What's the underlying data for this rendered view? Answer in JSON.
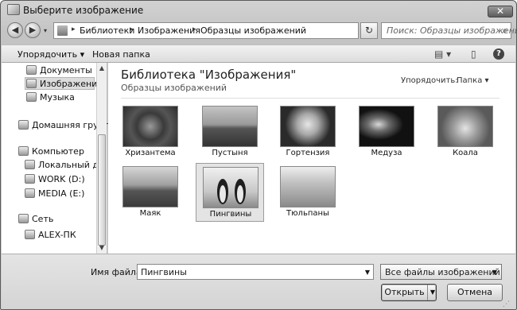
{
  "window": {
    "title": "Выберите изображение",
    "close": "✕"
  },
  "nav": {
    "back": "◀",
    "forward": "▶",
    "dropdown": "▾",
    "refresh": "↻"
  },
  "breadcrumb": [
    "Библиотеки",
    "Изображения",
    "Образцы изображений"
  ],
  "breadcrumb_sep": "▸",
  "search": {
    "placeholder": "Поиск: Образцы изображений",
    "icon": "search-icon"
  },
  "toolbar": {
    "organize": "Упорядочить ▾",
    "new_folder": "Новая папка",
    "view_icon": "▤ ▾",
    "preview_icon": "▯",
    "help_icon": "?"
  },
  "sidebar": {
    "items": [
      {
        "label": "Документы",
        "icon": "documents-icon"
      },
      {
        "label": "Изображения",
        "icon": "pictures-icon"
      },
      {
        "label": "Музыка",
        "icon": "music-icon"
      },
      {
        "label": "Домашняя группа",
        "icon": "homegroup-icon"
      },
      {
        "label": "Компьютер",
        "icon": "computer-icon"
      },
      {
        "label": "Локальный диск",
        "icon": "drive-icon"
      },
      {
        "label": "WORK (D:)",
        "icon": "drive-icon"
      },
      {
        "label": "MEDIA (E:)",
        "icon": "drive-icon"
      },
      {
        "label": "Сеть",
        "icon": "network-icon"
      },
      {
        "label": "ALEX-ПК",
        "icon": "pc-icon"
      }
    ]
  },
  "library": {
    "title": "Библиотека \"Изображения\"",
    "subtitle": "Образцы изображений",
    "arrange_label": "Упорядочить:",
    "arrange_value": "Папка ▾"
  },
  "images": [
    {
      "caption": "Хризантема",
      "selected": false,
      "color": "#4a4a4a"
    },
    {
      "caption": "Пустыня",
      "selected": false,
      "color": "#6f6f6f"
    },
    {
      "caption": "Гортензия",
      "selected": false,
      "color": "#3c3c3c"
    },
    {
      "caption": "Медуза",
      "selected": false,
      "color": "#1c1c1c"
    },
    {
      "caption": "Коала",
      "selected": false,
      "color": "#8a8a8a"
    },
    {
      "caption": "Маяк",
      "selected": false,
      "color": "#7c7c7c"
    },
    {
      "caption": "Пингвины",
      "selected": true,
      "color": "#9a9a9a"
    },
    {
      "caption": "Тюльпаны",
      "selected": false,
      "color": "#b8b8b8"
    }
  ],
  "bottom": {
    "filename_label": "Имя файла:",
    "filename_value": "Пингвины",
    "filter_value": "Все файлы изображений",
    "open_label": "Открыть",
    "cancel_label": "Отмена"
  }
}
